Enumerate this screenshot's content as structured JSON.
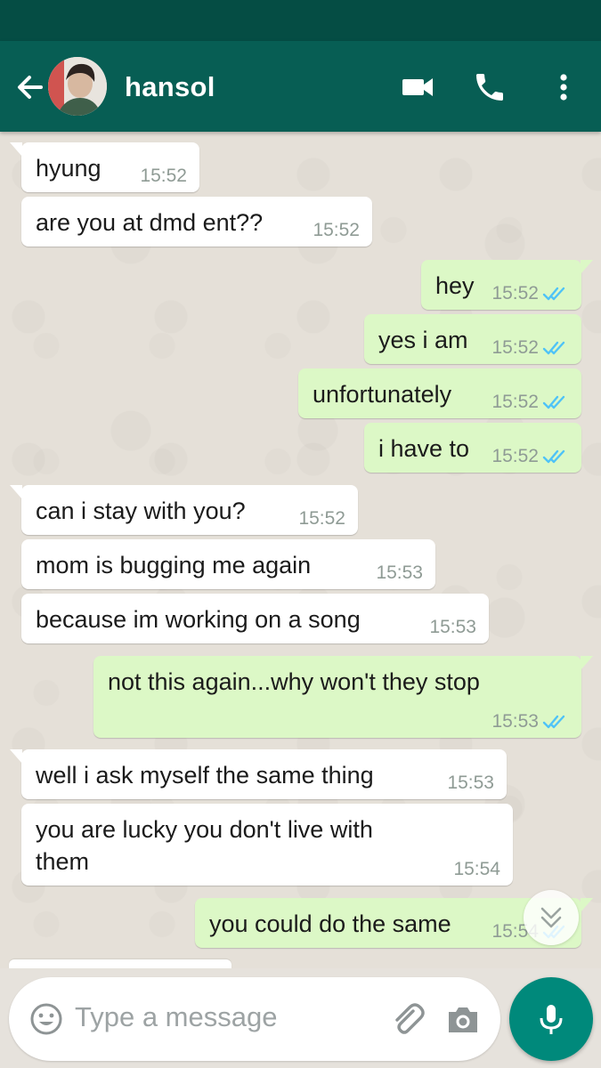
{
  "header": {
    "contact_name": "hansol",
    "back_icon": "arrow-left-icon",
    "actions": [
      "video-call-icon",
      "phone-icon",
      "more-vert-icon"
    ]
  },
  "messages": [
    {
      "dir": "in",
      "text": "hyung",
      "time": "15:52"
    },
    {
      "dir": "in",
      "text": "are you at dmd ent??",
      "time": "15:52"
    },
    {
      "dir": "out",
      "text": "hey",
      "time": "15:52",
      "status": "read"
    },
    {
      "dir": "out",
      "text": "yes i am",
      "time": "15:52",
      "status": "read"
    },
    {
      "dir": "out",
      "text": "unfortunately",
      "time": "15:52",
      "status": "read"
    },
    {
      "dir": "out",
      "text": "i have to",
      "time": "15:52",
      "status": "read"
    },
    {
      "dir": "in",
      "text": "can i stay with you?",
      "time": "15:52"
    },
    {
      "dir": "in",
      "text": "mom is bugging me again",
      "time": "15:53"
    },
    {
      "dir": "in",
      "text": "because im working on a song",
      "time": "15:53"
    },
    {
      "dir": "out",
      "text": "not this again...why won't they stop",
      "time": "15:53",
      "status": "read"
    },
    {
      "dir": "in",
      "text": "well i ask myself the same thing",
      "time": "15:53"
    },
    {
      "dir": "in",
      "text": "you are lucky you don't live with them",
      "time": "15:54"
    },
    {
      "dir": "out",
      "text": "you could do the same",
      "time": "15:54",
      "status": "read"
    }
  ],
  "composer": {
    "placeholder": "Type a message",
    "emoji_icon": "emoji-icon",
    "attach_icon": "paperclip-icon",
    "camera_icon": "camera-icon",
    "mic_icon": "microphone-icon"
  },
  "colors": {
    "header": "#075e54",
    "status_bar": "#054d44",
    "outgoing_bubble": "#dcf8c6",
    "incoming_bubble": "#ffffff",
    "read_ticks": "#4fc3f7",
    "fab": "#00897b"
  }
}
